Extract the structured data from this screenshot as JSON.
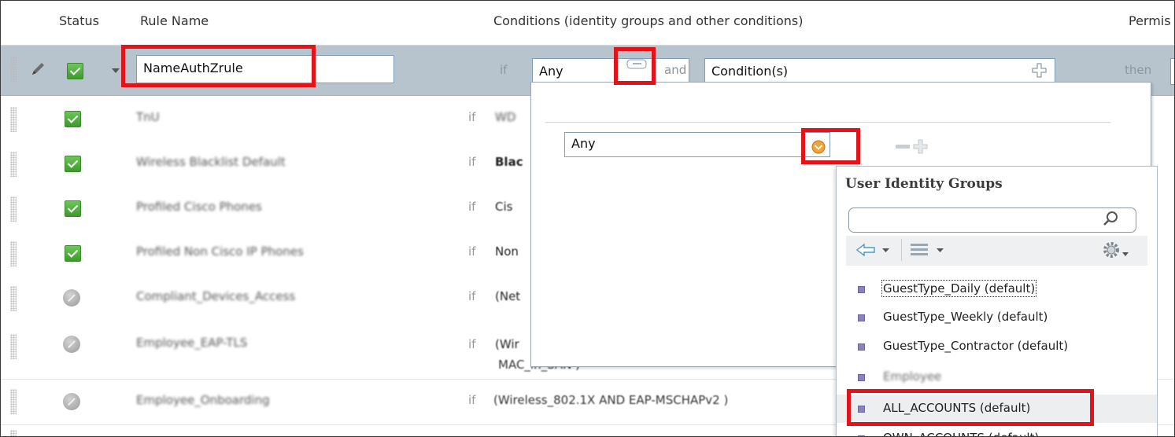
{
  "header": {
    "status": "Status",
    "rule_name": "Rule Name",
    "conditions": "Conditions (identity groups and other conditions)",
    "permissions": "Permis"
  },
  "edit_row": {
    "rule_name_value": "NameAuthZrule",
    "if_label": "if",
    "identity_value": "Any",
    "and_label": "and",
    "condition_placeholder": "Condition(s)",
    "then_label": "then"
  },
  "rows": [
    {
      "name": "TnU",
      "if": "if",
      "cond": "WD"
    },
    {
      "name": "Wireless Blacklist Default",
      "if": "if",
      "cond": "Blac"
    },
    {
      "name": "Profiled Cisco Phones",
      "if": "if",
      "cond": "Cis"
    },
    {
      "name": "Profiled Non Cisco IP Phones",
      "if": "if",
      "cond": "Non"
    },
    {
      "name": "Compliant_Devices_Access",
      "if": "if",
      "cond": "(Net"
    },
    {
      "name": "Employee_EAP-TLS",
      "if": "if",
      "cond": "(Wir",
      "cond2": "MAC_in_SAN )"
    },
    {
      "name": "Employee_Onboarding",
      "if": "if",
      "cond": "(Wireless_802.1X AND EAP-MSCHAPv2 )"
    }
  ],
  "popup": {
    "any_value": "Any"
  },
  "identity_groups": {
    "title": "User Identity Groups",
    "search_placeholder": "",
    "items": [
      "GuestType_Daily (default)",
      "GuestType_Weekly (default)",
      "GuestType_Contractor (default)",
      "Employee",
      "ALL_ACCOUNTS (default)",
      "OWN_ACCOUNTS (default)"
    ]
  },
  "colors": {
    "highlight_red": "#e3131b",
    "edit_row_bg": "#b7c4ce",
    "enabled_green": "#4caf3a",
    "group_icon": "#8b82b5"
  }
}
